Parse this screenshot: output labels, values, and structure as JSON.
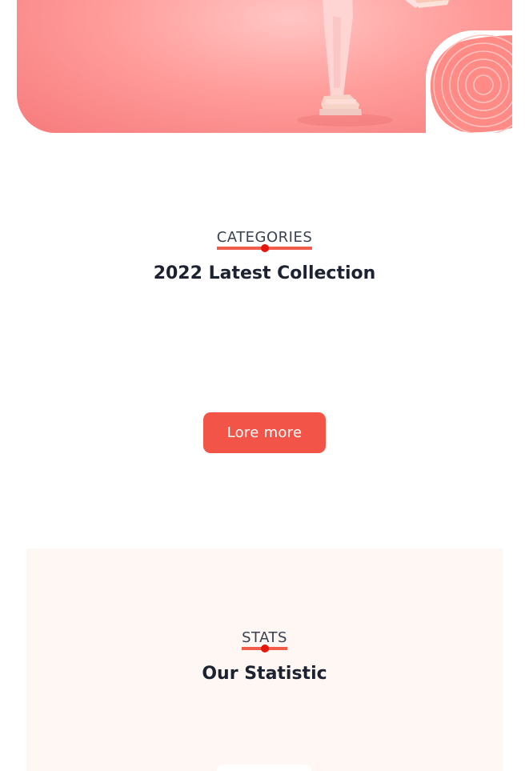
{
  "hero": {
    "image_alt": "Person in pink outfit wearing sandals",
    "decoration": "concentric-rings-icon"
  },
  "categories": {
    "tag": "CATEGORIES",
    "title": "2022 Latest Collection",
    "button_label": "Lore more"
  },
  "stats": {
    "tag": "STATS",
    "title": "Our Statistic"
  },
  "colors": {
    "accent": "#f25547",
    "dot": "#e8150c",
    "stats_bg": "#fff7f3",
    "hero_bg": "#ff9e9c"
  }
}
